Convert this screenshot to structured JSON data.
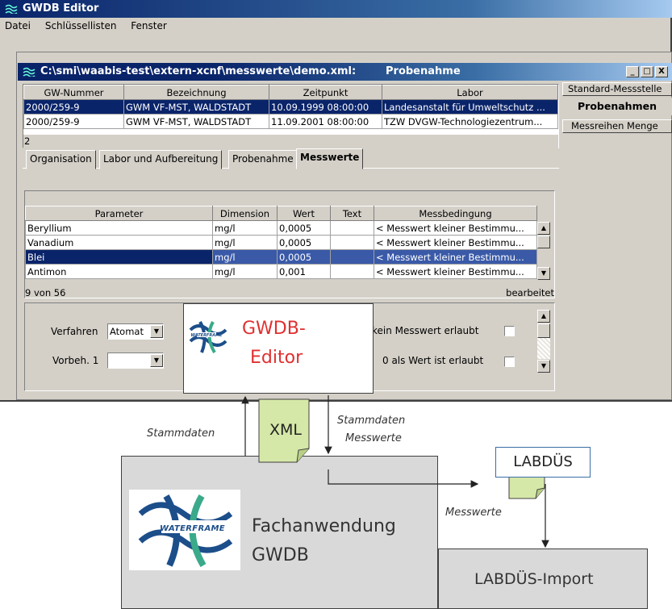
{
  "app": {
    "title": "GWDB Editor",
    "menu": [
      "Datei",
      "Schlüssellisten",
      "Fenster"
    ]
  },
  "doc_window": {
    "title_path": "C:\\smi\\waabis-test\\extern-xcnf\\messwerte\\demo.xml:",
    "title_section": "Probenahme",
    "buttons": [
      "_",
      "□",
      "X"
    ]
  },
  "side_tabs": [
    "Standard-Messstelle",
    "Probenahmen",
    "Messreihen Menge"
  ],
  "probe_table": {
    "headers": [
      "GW-Nummer",
      "Bezeichnung",
      "Zeitpunkt",
      "Labor"
    ],
    "rows": [
      [
        "2000/259-9",
        "GWM VF-MST, WALDSTADT",
        "10.09.1999 08:00:00",
        "Landesanstalt für Umweltschutz ..."
      ],
      [
        "2000/259-9",
        "GWM VF-MST, WALDSTADT",
        "11.09.2001 08:00:00",
        "TZW DVGW-Technologiezentrum..."
      ]
    ],
    "count": "2"
  },
  "tabs": [
    "Organisation",
    "Labor und Aufbereitung",
    "Probenahme",
    "Messwerte"
  ],
  "mess_table": {
    "headers": [
      "Parameter",
      "Dimension",
      "Wert",
      "Text",
      "Messbedingung"
    ],
    "rows": [
      [
        "Beryllium",
        "mg/l",
        "0,0005",
        "",
        "< Messwert kleiner Bestimmu..."
      ],
      [
        "Vanadium",
        "mg/l",
        "0,0005",
        "",
        "< Messwert kleiner Bestimmu..."
      ],
      [
        "Blei",
        "mg/l",
        "0,0005",
        "",
        "< Messwert kleiner Bestimmu..."
      ],
      [
        "Antimon",
        "mg/l",
        "0,001",
        "",
        "< Messwert kleiner Bestimmu..."
      ]
    ],
    "status_left": "9 von 56",
    "status_right": "bearbeitet"
  },
  "form": {
    "verfahren_label": "Verfahren",
    "verfahren_value": "Atomat",
    "vorbeh_label": "Vorbeh. 1",
    "vorbeh_value": "",
    "check1_label": "kein Messwert erlaubt",
    "check2_label": "0 als Wert ist erlaubt"
  },
  "diagram": {
    "editor_label_line1": "GWDB-",
    "editor_label_line2": "Editor",
    "xml_label": "XML",
    "stammdaten_left": "Stammdaten",
    "stammdaten_right_line1": "Stammdaten",
    "stammdaten_right_line2": "Messwerte",
    "labdus_label": "LABDÜS",
    "messwerte_label": "Messwerte",
    "fach_line1": "Fachanwendung",
    "fach_line2": "GWDB",
    "labdus_import": "LABDÜS-Import",
    "logo_text": "WATERFRAME",
    "accent_red": "#e03030",
    "wf_blue": "#1c4e8a",
    "wf_teal": "#3aaa8a"
  }
}
